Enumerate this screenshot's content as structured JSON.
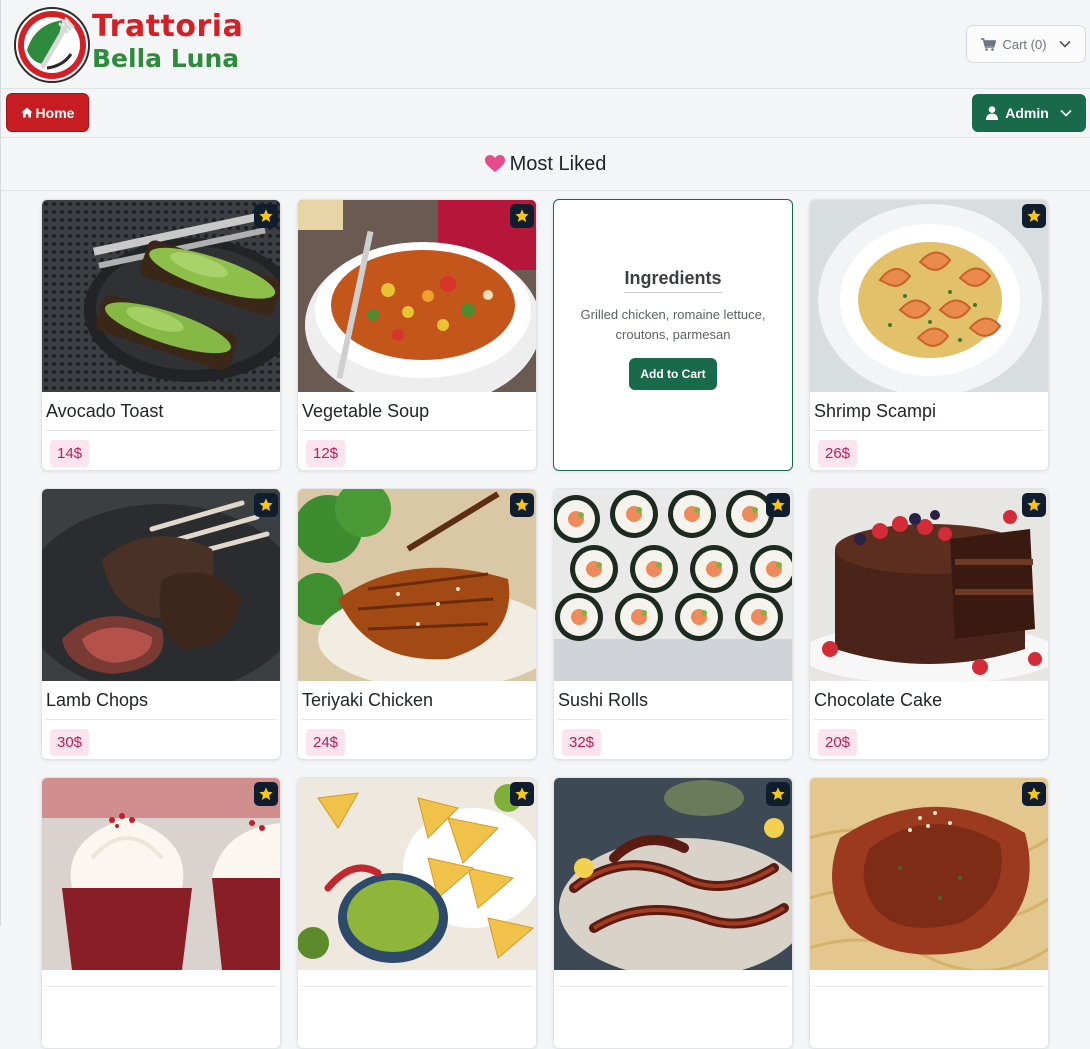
{
  "brand": {
    "line1": "Trattoria",
    "line2": "Bella Luna"
  },
  "header": {
    "cart_label": "Cart (0)"
  },
  "nav": {
    "home_label": "Home",
    "admin_label": "Admin"
  },
  "section": {
    "title": "Most Liked"
  },
  "cards": [
    {
      "name": "Avocado Toast",
      "price": "14$"
    },
    {
      "name": "Vegetable Soup",
      "price": "12$"
    },
    {
      "flip": true,
      "ingredients_title": "Ingredients",
      "ingredients": "Grilled chicken, romaine lettuce, croutons, parmesan",
      "button": "Add to Cart"
    },
    {
      "name": "Shrimp Scampi",
      "price": "26$"
    },
    {
      "name": "Lamb Chops",
      "price": "30$"
    },
    {
      "name": "Teriyaki Chicken",
      "price": "24$"
    },
    {
      "name": "Sushi Rolls",
      "price": "32$"
    },
    {
      "name": "Chocolate Cake",
      "price": "20$"
    },
    {
      "name": "",
      "price": ""
    },
    {
      "name": "",
      "price": ""
    },
    {
      "name": "",
      "price": ""
    },
    {
      "name": "",
      "price": ""
    }
  ],
  "colors": {
    "brand_red": "#d32027",
    "brand_green": "#2e8b3e",
    "admin_green": "#186a4b",
    "price_bg": "#fbe4ee",
    "price_text": "#b3205a",
    "heart": "#e84a8a",
    "star": "#f5c518"
  }
}
